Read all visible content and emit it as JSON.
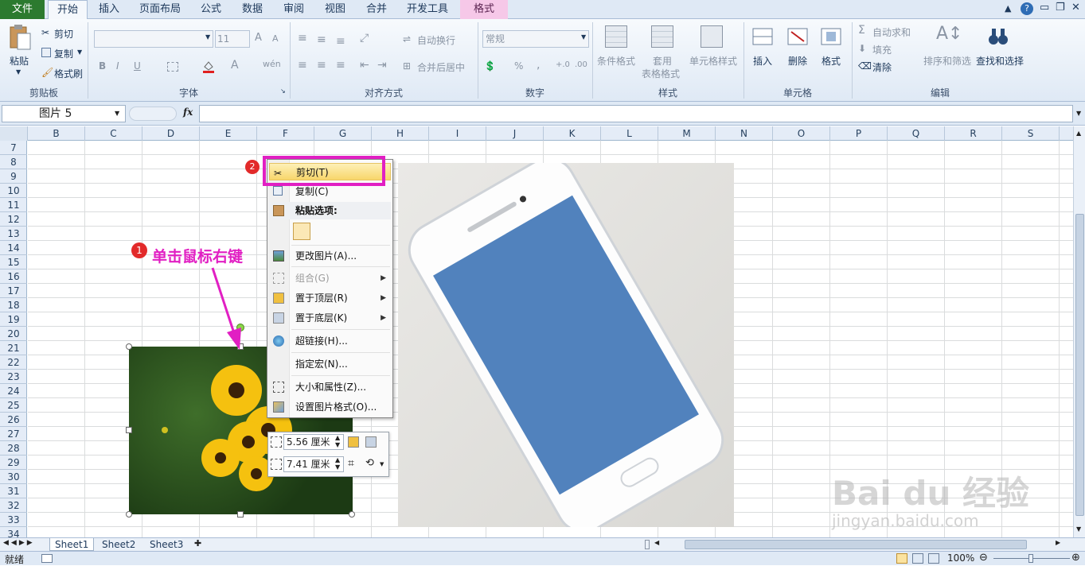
{
  "tabs": {
    "file": "文件",
    "home": "开始",
    "insert": "插入",
    "page_layout": "页面布局",
    "formulas": "公式",
    "data": "数据",
    "review": "审阅",
    "view": "视图",
    "merge": "合并",
    "developer": "开发工具",
    "format": "格式"
  },
  "clipboard": {
    "paste": "粘贴",
    "cut": "剪切",
    "copy": "复制",
    "format_painter": "格式刷",
    "label": "剪贴板"
  },
  "font": {
    "size": "11",
    "label": "字体",
    "bold": "B",
    "italic": "I",
    "underline": "U",
    "grow": "A",
    "shrink": "A",
    "color": "A"
  },
  "alignment": {
    "wrap": "自动换行",
    "merge_center": "合并后居中",
    "label": "对齐方式"
  },
  "number": {
    "format": "常规",
    "percent": "%",
    "comma": ",",
    "label": "数字"
  },
  "styles": {
    "conditional": "条件格式",
    "table_format_1": "套用",
    "table_format_2": "表格格式",
    "cell_styles": "单元格样式",
    "label": "样式"
  },
  "cells": {
    "insert": "插入",
    "delete": "删除",
    "format": "格式",
    "label": "单元格"
  },
  "editing": {
    "autosum": "自动求和",
    "fill": "填充",
    "clear": "清除",
    "sort_filter": "排序和筛选",
    "find_select": "查找和选择",
    "label": "编辑"
  },
  "formula_bar": {
    "name_box": "图片 5",
    "fx": "fx"
  },
  "columns": [
    "B",
    "C",
    "D",
    "E",
    "F",
    "G",
    "H",
    "I",
    "J",
    "K",
    "L",
    "M",
    "N",
    "O",
    "P",
    "Q",
    "R",
    "S"
  ],
  "rows": [
    "7",
    "8",
    "9",
    "10",
    "11",
    "12",
    "13",
    "14",
    "15",
    "16",
    "17",
    "18",
    "19",
    "20",
    "21",
    "22",
    "23",
    "24",
    "25",
    "26",
    "27",
    "28",
    "29",
    "30",
    "31",
    "32",
    "33",
    "34"
  ],
  "context_menu": {
    "cut": "剪切(T)",
    "copy": "复制(C)",
    "paste_options": "粘贴选项:",
    "change_picture": "更改图片(A)...",
    "group": "组合(G)",
    "bring_front": "置于顶层(R)",
    "send_back": "置于底层(K)",
    "hyperlink": "超链接(H)...",
    "assign_macro": "指定宏(N)...",
    "size_props": "大小和属性(Z)...",
    "format_picture": "设置图片格式(O)..."
  },
  "mini_toolbar": {
    "height": "5.56 厘米",
    "width": "7.41 厘米"
  },
  "annotation": {
    "step1_num": "1",
    "step1_text": "单击鼠标右键",
    "step2_num": "2"
  },
  "sheets": [
    "Sheet1",
    "Sheet2",
    "Sheet3"
  ],
  "status": {
    "ready": "就绪",
    "zoom": "100%"
  },
  "watermark": {
    "brand": "Bai du 经验",
    "url": "jingyan.baidu.com"
  },
  "colors": {
    "highlight": "#e11fc3",
    "annotation": "#e11fc3",
    "file_tab": "#2c7a2f",
    "phone_screen": "#5182bd"
  }
}
